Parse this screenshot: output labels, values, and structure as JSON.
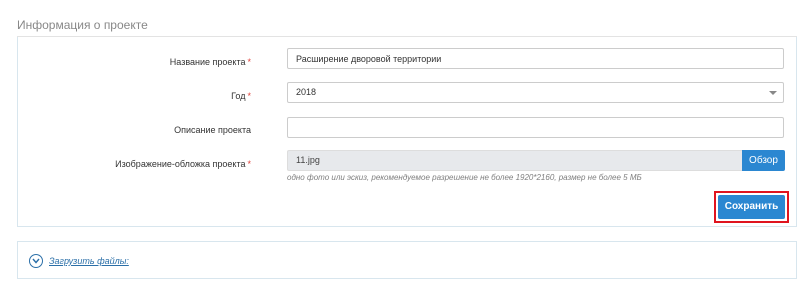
{
  "section": {
    "title": "Информация о проекте"
  },
  "form": {
    "name": {
      "label": "Название проекта",
      "required": "*",
      "value": "Расширение дворовой территории"
    },
    "year": {
      "label": "Год",
      "required": "*",
      "value": "2018"
    },
    "description": {
      "label": "Описание проекта",
      "value": ""
    },
    "cover_image": {
      "label": "Изображение-обложка проекта",
      "required": "*",
      "file_name": "11.jpg",
      "browse_label": "Обзор",
      "hint": "одно фото или эскиз, рекомендуемое разрешение не более 1920*2160, размер не более 5 МБ"
    },
    "save_label": "Сохранить"
  },
  "upload": {
    "link_label": "Загрузить файлы:",
    "icon": "chevron-down-circle-icon"
  },
  "colors": {
    "accent": "#2b87d1",
    "link": "#2b6fa8",
    "required": "#e0413a",
    "highlight": "#e0141e"
  }
}
